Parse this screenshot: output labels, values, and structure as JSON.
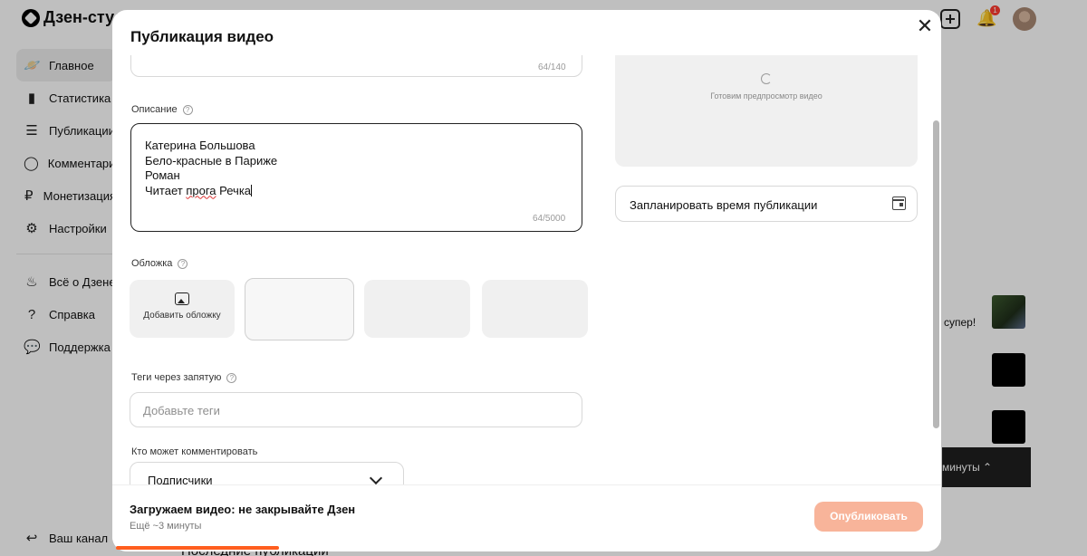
{
  "app": {
    "logo": "Дзен-студ",
    "notifications_count": "1"
  },
  "sidebar": {
    "items": [
      {
        "label": "Главное",
        "icon": "planet-icon"
      },
      {
        "label": "Статистика",
        "icon": "chart-icon"
      },
      {
        "label": "Публикации",
        "icon": "stack-icon"
      },
      {
        "label": "Комментарии",
        "icon": "comment-icon"
      },
      {
        "label": "Монетизация",
        "icon": "ruble-icon"
      },
      {
        "label": "Настройки",
        "icon": "gear-icon"
      }
    ],
    "secondary": [
      {
        "label": "Всё о Дзене",
        "icon": "fire-icon"
      },
      {
        "label": "Справка",
        "icon": "question-icon"
      },
      {
        "label": "Поддержка",
        "icon": "chat-icon"
      }
    ],
    "bottom": {
      "label": "Ваш канал",
      "icon": "back-icon"
    }
  },
  "background": {
    "comment_snippet": "супер!",
    "pill_text": "минуты",
    "latest_header": "Последние публикации"
  },
  "modal": {
    "title": "Публикация видео",
    "title_counter": "64/140",
    "description": {
      "label": "Описание",
      "lines": [
        "Катерина Большова",
        "Бело-красные в Париже",
        "Роман"
      ],
      "last_line_prefix": "Читает ",
      "last_line_misspelled": "прога",
      "last_line_suffix": " Речка",
      "counter": "64/5000"
    },
    "cover": {
      "label": "Обложка",
      "add_label": "Добавить обложку"
    },
    "tags": {
      "label": "Теги через запятую",
      "placeholder": "Добавьте теги"
    },
    "comments": {
      "label": "Кто может комментировать",
      "value": "Подписчики"
    },
    "preview": {
      "text": "Готовим предпросмотр видео"
    },
    "schedule": {
      "label": "Запланировать время публикации"
    },
    "footer": {
      "status": "Загружаем видео: не закрывайте Дзен",
      "eta": "Ещё ~3 минуты",
      "publish_label": "Опубликовать"
    }
  }
}
